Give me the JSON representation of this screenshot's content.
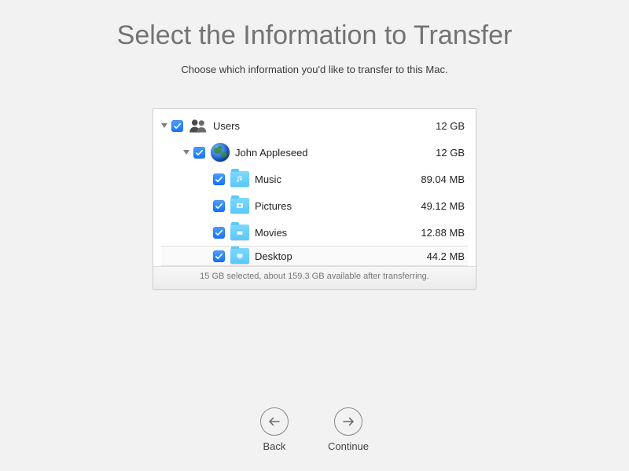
{
  "title": "Select the Information to Transfer",
  "subtitle": "Choose which information you'd like to transfer to this Mac.",
  "tree": {
    "users": {
      "label": "Users",
      "size": "12 GB"
    },
    "user1": {
      "label": "John Appleseed",
      "size": "12 GB"
    },
    "music": {
      "label": "Music",
      "size": "89.04 MB"
    },
    "pictures": {
      "label": "Pictures",
      "size": "49.12 MB"
    },
    "movies": {
      "label": "Movies",
      "size": "12.88 MB"
    },
    "desktop": {
      "label": "Desktop",
      "size": "44.2 MB"
    }
  },
  "status": "15 GB selected, about 159.3 GB available after transferring.",
  "nav": {
    "back": "Back",
    "continue": "Continue"
  }
}
